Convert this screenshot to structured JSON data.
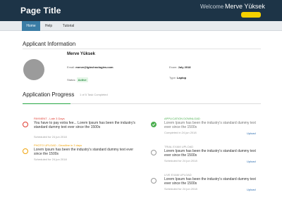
{
  "header": {
    "title": "Page Title",
    "welcome": "Welcome",
    "user_name": "Merve Yüksek"
  },
  "nav": {
    "items": [
      {
        "label": "Home",
        "active": true
      },
      {
        "label": "Help",
        "active": false
      },
      {
        "label": "Tutorial",
        "active": false
      }
    ]
  },
  "applicant": {
    "section_title": "Applicant Information",
    "name": "Merve Yüksek",
    "email_label": "Email:",
    "email": "merve@lgtechnologies.com",
    "status_label": "Status:",
    "status": "Active",
    "exam_label": "Exam:",
    "exam": "July 2018",
    "type_label": "Type:",
    "type": "Laptop"
  },
  "progress": {
    "section_title": "Application Progress",
    "caption": "1 of 5 Task Completed",
    "completed": 1,
    "total": 5
  },
  "tasks": [
    {
      "label": "PAYMENT - Late 3 Days",
      "desc": "You have to pay extra fee... Lorem Ipsum has been the industry's standard dummy text ever since the 1500s",
      "date": "Scheduled for 24 jun 2018",
      "status": "late",
      "color": "#e03c31",
      "link": ""
    },
    {
      "label": "PHOTO UPLOAD - Deadline in 3 days",
      "desc": "Lorem Ipsum has been the industry's standard dummy text ever since the 1500s",
      "date": "Scheduled for 24 jun 2018",
      "status": "warning",
      "color": "#f0a30a",
      "link": ""
    },
    {
      "label": "APPLICATION DOWNLOAD",
      "desc": "Lorem Ipsum has been the industry's standard dummy text ever since the 1500s",
      "date": "Completed in 24 jun 2018",
      "status": "done",
      "color": "#4caf50",
      "link": "Upload"
    },
    {
      "label": "TRIAL EXAM UPLOAD",
      "desc": "Lorem Ipsum has been the industry's standard dummy text ever since the 1500s",
      "date": "Scheduled for 24 jun 2018",
      "status": "pending",
      "color": "#999999",
      "link": "Upload"
    },
    {
      "label": "LIVE EXAM UPLOAD",
      "desc": "Lorem Ipsum has been the industry's standard dummy text ever since the 1500s",
      "date": "Scheduled for 24 jun 2018",
      "status": "pending",
      "color": "#999999",
      "link": "Upload"
    }
  ],
  "colors": {
    "header_bg": "#1d3447",
    "accent_yellow": "#f5d000",
    "nav_active": "#3a7ca5",
    "success": "#28a745",
    "danger": "#e03c31",
    "warning": "#f0a30a",
    "link": "#2b6cb0"
  }
}
